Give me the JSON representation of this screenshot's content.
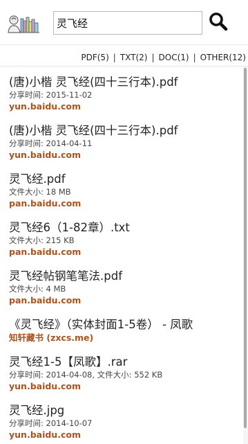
{
  "search": {
    "value": "灵飞经",
    "placeholder": ""
  },
  "filters": [
    {
      "label": "PDF(5)"
    },
    {
      "label": "TXT(2)"
    },
    {
      "label": "DOC(1)"
    },
    {
      "label": "OTHER(12)"
    }
  ],
  "filter_separator": "|",
  "results": [
    {
      "title": "(唐)小楷 灵飞经(四十三行本).pdf",
      "meta": "分享时间: 2015-11-02",
      "source": "yun.baidu.com"
    },
    {
      "title": "(唐)小楷 灵飞经(四十三行本).pdf",
      "meta": "分享时间: 2014-04-11",
      "source": "yun.baidu.com"
    },
    {
      "title": "灵飞经.pdf",
      "meta": "文件大小: 18 MB",
      "source": "pan.baidu.com"
    },
    {
      "title": "灵飞经6（1-82章）.txt",
      "meta": "文件大小: 215 KB",
      "source": "pan.baidu.com"
    },
    {
      "title": "灵飞经帖钢笔笔法.pdf",
      "meta": "文件大小: 4 MB",
      "source": "pan.baidu.com"
    },
    {
      "title": "《灵飞经》（实体封面1-5卷） - 凤歌",
      "meta": "",
      "source": "知轩藏书 (zxcs.me)"
    },
    {
      "title": "灵飞经1-5【凤歌】.rar",
      "meta": "分享时间: 2014-04-08, 文件大小: 552 KB",
      "source": "yun.baidu.com"
    },
    {
      "title": "灵飞经.jpg",
      "meta": "分享时间: 2014-10-07",
      "source": "yun.baidu.com"
    }
  ],
  "colors": {
    "source_link": "#a85421",
    "text": "#222222",
    "scroll_thumb": "#a9a9a9"
  },
  "icons": {
    "logo": "reading-person-books-logo",
    "search": "magnifier-icon"
  }
}
